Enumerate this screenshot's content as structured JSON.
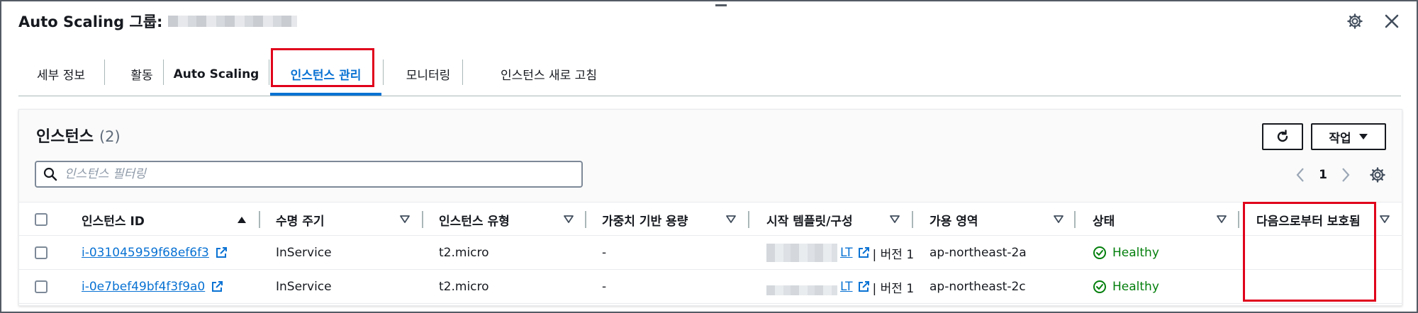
{
  "header": {
    "title": "Auto Scaling 그룹:"
  },
  "tabs": [
    {
      "label": "세부 정보",
      "active": false
    },
    {
      "label": "활동",
      "active": false
    },
    {
      "label": "Auto Scaling",
      "active": false
    },
    {
      "label": "인스턴스 관리",
      "active": true
    },
    {
      "label": "모니터링",
      "active": false
    },
    {
      "label": "인스턴스 새로 고침",
      "active": false
    }
  ],
  "panel": {
    "title": "인스턴스",
    "count": "(2)",
    "action_button": "작업",
    "filter_placeholder": "인스턴스 필터링",
    "page": "1"
  },
  "table": {
    "columns": [
      "인스턴스 ID",
      "수명 주기",
      "인스턴스 유형",
      "가중치 기반 용량",
      "시작 템플릿/구성",
      "가용 영역",
      "상태",
      "다음으로부터 보호됨"
    ],
    "rows": [
      {
        "id": "i-031045959f68ef6f3",
        "lifecycle": "InService",
        "type": "t2.micro",
        "weight": "-",
        "template_suffix": "LT",
        "template_version": "| 버전 1",
        "az": "ap-northeast-2a",
        "status": "Healthy",
        "protected": ""
      },
      {
        "id": "i-0e7bef49bf4f3f9a0",
        "lifecycle": "InService",
        "type": "t2.micro",
        "weight": "-",
        "template_suffix": "LT",
        "template_version": "| 버전 1",
        "az": "ap-northeast-2c",
        "status": "Healthy",
        "protected": ""
      }
    ]
  },
  "colors": {
    "accent": "#0972d3",
    "success": "#037f0c",
    "highlight": "#e0001b"
  },
  "icons": [
    "settings-icon",
    "close-icon",
    "refresh-icon",
    "caret-down-icon",
    "search-icon",
    "chevron-left-icon",
    "chevron-right-icon",
    "sort-asc-icon",
    "sort-desc-icon",
    "external-link-icon",
    "status-ok-icon"
  ]
}
